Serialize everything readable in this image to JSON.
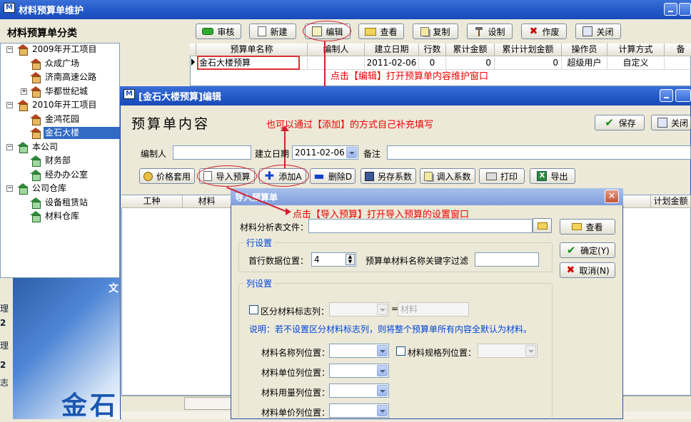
{
  "main_window": {
    "title": "材料预算单维护",
    "icon_text": "M"
  },
  "tree": {
    "title": "材料预算单分类",
    "items": [
      {
        "label": "2009年开工项目",
        "level": 0,
        "expander": "−",
        "icon": "house-icon"
      },
      {
        "label": "众成广场",
        "level": 1,
        "icon": "house-icon"
      },
      {
        "label": "济南高速公路",
        "level": 1,
        "icon": "house-icon"
      },
      {
        "label": "华都世纪城",
        "level": 1,
        "expander": "+",
        "icon": "house-icon"
      },
      {
        "label": "2010年开工项目",
        "level": 0,
        "expander": "−",
        "icon": "house-icon"
      },
      {
        "label": "金鸿花园",
        "level": 1,
        "icon": "house-icon"
      },
      {
        "label": "金石大楼",
        "level": 1,
        "icon": "house-icon",
        "selected": true
      },
      {
        "label": "本公司",
        "level": 0,
        "expander": "−",
        "icon": "house-green-icon"
      },
      {
        "label": "财务部",
        "level": 1,
        "icon": "house-green-icon"
      },
      {
        "label": "经办办公室",
        "level": 1,
        "icon": "house-green-icon"
      },
      {
        "label": "公司仓库",
        "level": 0,
        "expander": "−",
        "icon": "house-green-icon"
      },
      {
        "label": "设备租赁站",
        "level": 1,
        "icon": "house-green-icon"
      },
      {
        "label": "材料仓库",
        "level": 1,
        "icon": "house-green-icon"
      }
    ]
  },
  "left_bottom": {
    "side_texts": [
      "理",
      "2",
      "理",
      "2",
      "志"
    ],
    "banner_text": "金石",
    "banner_small": "文"
  },
  "toolbar": {
    "audit": "审核",
    "new": "新建",
    "edit": "编辑",
    "view": "查看",
    "copy": "复制",
    "setup": "设制",
    "void": "作废",
    "close": "关闭"
  },
  "main_grid": {
    "headers": [
      "预算单名称",
      "编制人",
      "建立日期",
      "行数",
      "累计金额",
      "累计计划金额",
      "操作员",
      "计算方式",
      "备"
    ],
    "rows": [
      [
        "金石大楼预算",
        "",
        "2011-02-06",
        "0",
        "0",
        "0",
        "超级用户",
        "自定义",
        ""
      ]
    ]
  },
  "annotations": {
    "edit_hint": "点击【编辑】打开预算单内容维护窗口",
    "add_hint": "也可以通过【添加】的方式自己补充填写",
    "import_hint": "点击【导入预算】打开导入预算的设置窗口"
  },
  "edit_window": {
    "title": "[金石大楼预算]编辑",
    "heading": "预算单内容",
    "save": "保存",
    "close": "关闭",
    "editor_label": "编制人",
    "editor_value": "",
    "date_label": "建立日期",
    "date_value": "2011-02-06",
    "note_label": "备注",
    "note_value": "",
    "buttons": {
      "price": "价格套用",
      "import": "导入预算",
      "add": "添加A",
      "delete": "删除D",
      "save_coef": "另存系数",
      "load_coef": "调入系数",
      "print": "打印",
      "export": "导出"
    },
    "grid_headers": [
      "工种",
      "材料",
      "计划金额"
    ]
  },
  "import_dialog": {
    "title": "导入预算单",
    "file_label": "材料分析表文件：",
    "file_value": "",
    "view": "查看",
    "ok": "确定(Y)",
    "cancel": "取消(N)",
    "row_group": "行设置",
    "first_row_label": "首行数据位置：",
    "first_row_value": "4",
    "keyword_label": "预算单材料名称关键字过滤",
    "keyword_value": "",
    "col_group": "列设置",
    "flag_col_label": "区分材料标志列：",
    "flag_eq": "=",
    "flag_value": "材料",
    "note": "说明：若不设置区分材料标志列，则将整个预算单所有内容全默认为材料。",
    "name_col": "材料名称列位置：",
    "spec_col": "材料规格列位置：",
    "unit_col": "材料单位列位置：",
    "qty_col": "材料用量列位置：",
    "price_col": "材料单价列位置："
  }
}
